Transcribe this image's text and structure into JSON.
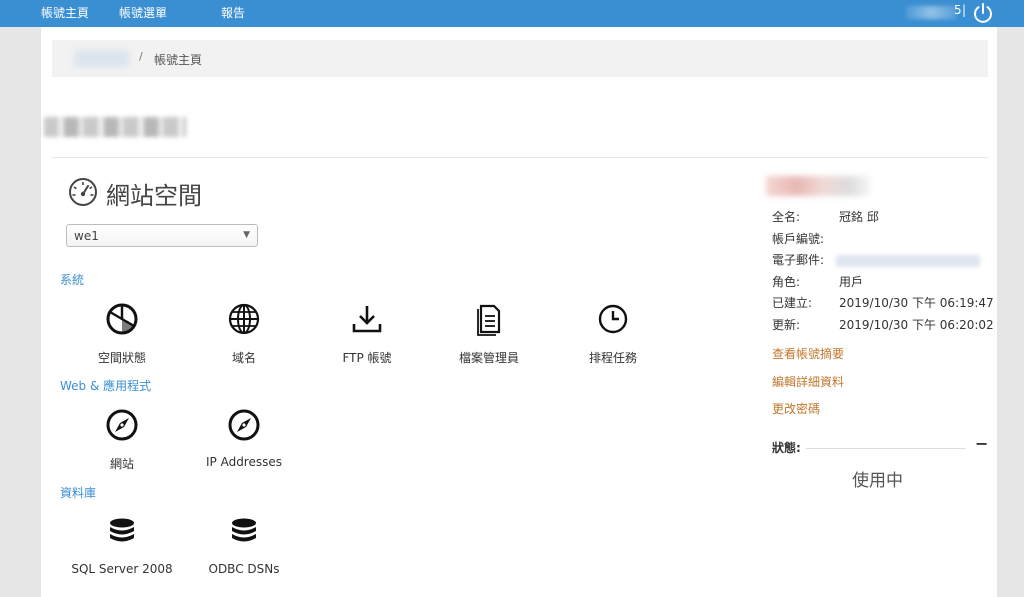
{
  "topbar": {
    "nav": [
      "帳號主頁",
      "帳號選單",
      "報告"
    ],
    "user_suffix": "5",
    "separator": "|",
    "power_icon": "power-icon"
  },
  "breadcrumb": {
    "separator": "/",
    "current": "帳號主頁"
  },
  "webspace": {
    "title": "網站空間",
    "icon": "speedometer-icon",
    "selected": "we1"
  },
  "sections": [
    {
      "title": "系統",
      "items": [
        {
          "label": "空間狀態",
          "icon": "pie-chart-icon"
        },
        {
          "label": "域名",
          "icon": "globe-icon"
        },
        {
          "label": "FTP 帳號",
          "icon": "download-icon"
        },
        {
          "label": "檔案管理員",
          "icon": "document-icon"
        },
        {
          "label": "排程任務",
          "icon": "clock-icon"
        }
      ]
    },
    {
      "title": "Web & 應用程式",
      "items": [
        {
          "label": "網站",
          "icon": "compass-icon"
        },
        {
          "label": "IP Addresses",
          "icon": "compass-icon"
        }
      ]
    },
    {
      "title": "資料庫",
      "items": [
        {
          "label": "SQL Server 2008",
          "icon": "database-icon"
        },
        {
          "label": "ODBC DSNs",
          "icon": "database-icon"
        }
      ]
    }
  ],
  "account": {
    "fields": [
      {
        "key": "全名:",
        "value": "冠銘 邱"
      },
      {
        "key": "帳戶編號:",
        "value": ""
      },
      {
        "key": "電子郵件:",
        "value": ""
      },
      {
        "key": "角色:",
        "value": "用戶"
      },
      {
        "key": "已建立:",
        "value": "2019/10/30 下午 06:19:47"
      },
      {
        "key": "更新:",
        "value": "2019/10/30 下午 06:20:02"
      }
    ],
    "links": [
      "查看帳號摘要",
      "編輯詳細資料",
      "更改密碼"
    ],
    "status_label": "狀態:",
    "status_toggle": "−",
    "status_value": "使用中"
  },
  "colors": {
    "topbar": "#3a8fd3",
    "section": "#3a8fd3",
    "link": "#c0782f"
  }
}
